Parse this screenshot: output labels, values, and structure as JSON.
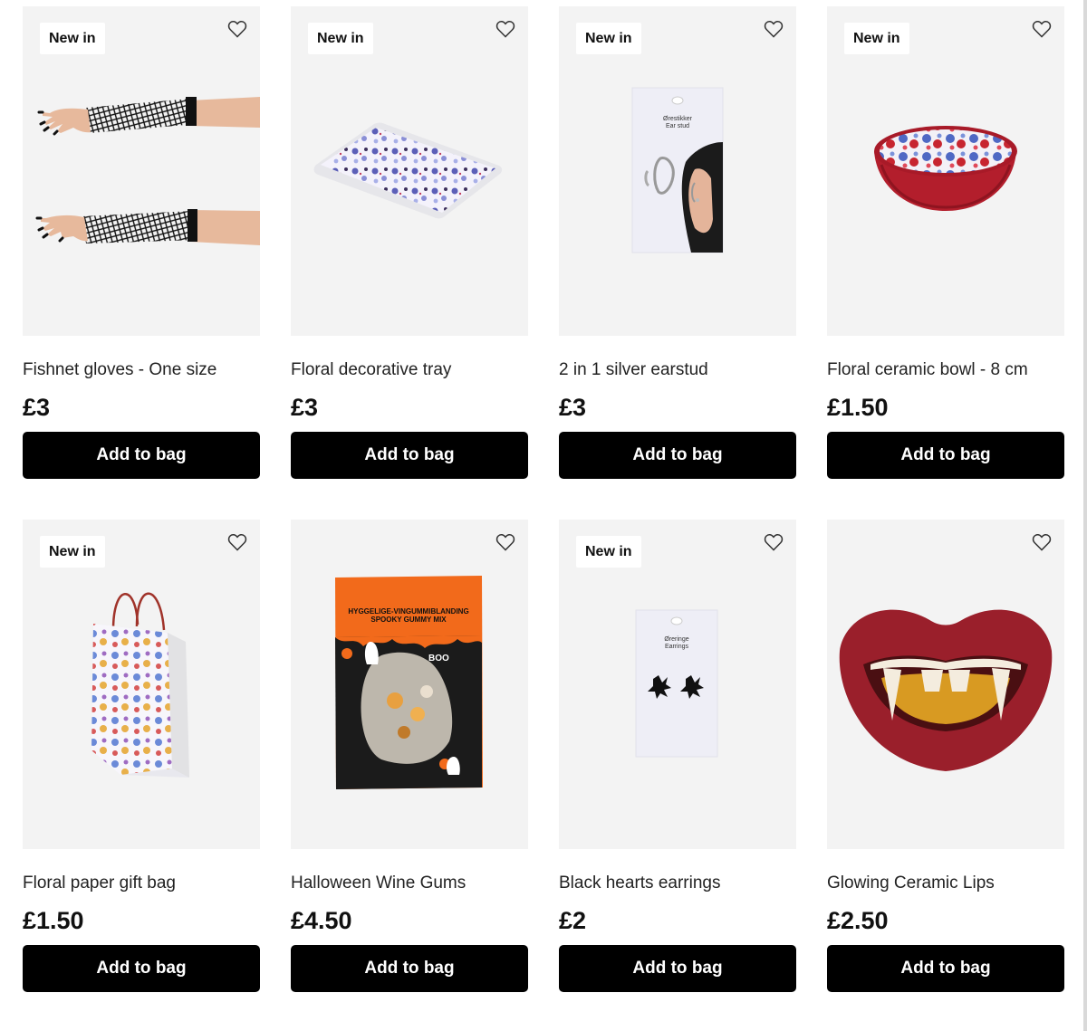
{
  "badge_text": "New in",
  "button_label": "Add to bag",
  "products": [
    {
      "name": "Fishnet gloves - One size",
      "price": "£3",
      "new": true,
      "image": "fishnet-gloves"
    },
    {
      "name": "Floral decorative tray",
      "price": "£3",
      "new": true,
      "image": "floral-tray"
    },
    {
      "name": "2 in 1 silver earstud",
      "price": "£3",
      "new": true,
      "image": "earstud-card",
      "card_text": {
        "line1": "Ørestikker",
        "line2": "Ear stud"
      }
    },
    {
      "name": "Floral ceramic bowl - 8 cm",
      "price": "£1.50",
      "new": true,
      "image": "floral-bowl"
    },
    {
      "name": "Floral paper gift bag",
      "price": "£1.50",
      "new": true,
      "image": "gift-bag"
    },
    {
      "name": "Halloween Wine Gums",
      "price": "£4.50",
      "new": false,
      "image": "wine-gums",
      "pack_text": {
        "line1": "HYGGELIGE-VINGUMMIBLANDING",
        "line2": "SPOOKY GUMMY MIX",
        "boo": "BOO"
      }
    },
    {
      "name": "Black hearts earrings",
      "price": "£2",
      "new": true,
      "image": "earrings-card",
      "card_text": {
        "line1": "Øreringe",
        "line2": "Earrings"
      }
    },
    {
      "name": "Glowing Ceramic Lips",
      "price": "£2.50",
      "new": false,
      "image": "vampire-lips"
    }
  ],
  "icons": {
    "favourite": "heart-outline-icon"
  }
}
